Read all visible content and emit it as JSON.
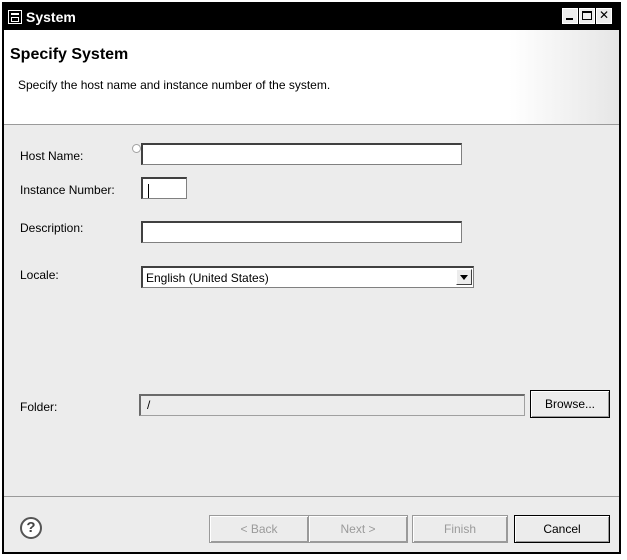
{
  "window": {
    "title": "System",
    "controls": {
      "minimize": "_",
      "maximize": "□",
      "close": "✕"
    }
  },
  "header": {
    "title": "Specify System",
    "description": "Specify the host name and instance number of the system."
  },
  "form": {
    "host_name": {
      "label": "Host Name:",
      "value": ""
    },
    "instance_number": {
      "label": "Instance Number:",
      "value": ""
    },
    "description": {
      "label": "Description:",
      "value": ""
    },
    "locale": {
      "label": "Locale:",
      "selected": "English (United States)"
    },
    "folder": {
      "label": "Folder:",
      "value": "/",
      "browse_label": "Browse..."
    }
  },
  "footer": {
    "help_symbol": "?",
    "back_label": "< Back",
    "next_label": "Next >",
    "finish_label": "Finish",
    "cancel_label": "Cancel"
  },
  "icons": {
    "title": "window-app-icon",
    "help": "help-icon",
    "required": "required-field-indicator-icon",
    "dropdown": "chevron-down-icon"
  }
}
